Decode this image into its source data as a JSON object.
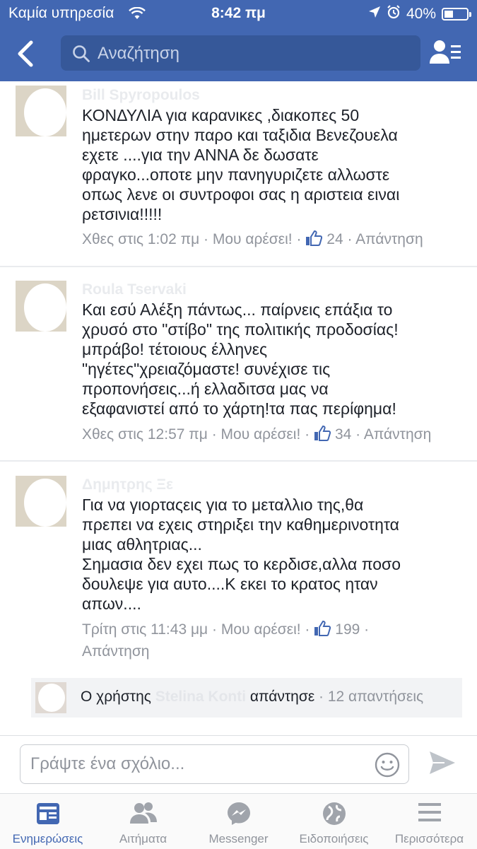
{
  "status_bar": {
    "carrier": "Καμία υπηρεσία",
    "time": "8:42 πμ",
    "battery": "40%",
    "battery_level": 0.4
  },
  "nav": {
    "search_placeholder": "Αναζήτηση"
  },
  "comments": [
    {
      "author": "Bill Spyropoulos",
      "lines": [
        "ΚΟΝΔΥΛΙΑ για καρανικες ,διακοπες 50",
        "ημετερων στην παρο και ταξιδια Βενεζουελα",
        "εχετε ....για την ΑΝΝΑ δε δωσατε",
        "φραγκο...οποτε μην πανηγυριζετε αλλωστε",
        "οπως λενε οι συντροφοι σας η αριστεια ειναι",
        "ρετσινια!!!!!"
      ],
      "time": "Χθες στις 1:02 πμ",
      "like_label": "Μου αρέσει!",
      "like_count": "24",
      "reply_label": "Απάντηση"
    },
    {
      "author": "Roula Tservaki",
      "lines": [
        "Και εσύ Αλέξη πάντως... παίρνεις επάξια το",
        "χρυσό στο \"στίβο\" της πολιτικής προδοσίας!",
        "μπράβο! τέτοιους έλληνες",
        "\"ηγέτες\"χρειαζόμαστε! συνέχισε τις",
        "προπονήσεις...ή ελλαδιτσα μας να",
        "εξαφανιστεί από το χάρτη!τα πας περίφημα!"
      ],
      "time": "Χθες στις 12:57 πμ",
      "like_label": "Μου αρέσει!",
      "like_count": "34",
      "reply_label": "Απάντηση"
    },
    {
      "author": "Δημητρης Ξε",
      "lines": [
        "Για να γιορταςεις για το μεταλλιο της,θα",
        "πρεπει να εχεις στηριξει την καθημερινοτητα",
        "μιας αθλητριας...",
        "Σημασια δεν εχει πως το κερδισε,αλλα ποσο",
        "δουλεψε για αυτο....Κ εκει το κρατος ηταν",
        "απων...."
      ],
      "time": "Τρίτη στις 11:43 μμ",
      "like_label": "Μου αρέσει!",
      "like_count": "199",
      "reply_label": "Απάντηση"
    }
  ],
  "replies_row": {
    "prefix": "Ο χρήστης",
    "name": "Stelina Konti",
    "action": "απάντησε",
    "count": "12 απαντήσεις"
  },
  "compose": {
    "placeholder": "Γράψτε ένα σχόλιο..."
  },
  "tabs": [
    {
      "label": "Ενημερώσεις",
      "icon": "news-feed-icon",
      "active": true
    },
    {
      "label": "Αιτήματα",
      "icon": "friend-requests-icon",
      "active": false
    },
    {
      "label": "Messenger",
      "icon": "messenger-icon",
      "active": false
    },
    {
      "label": "Ειδοποιήσεις",
      "icon": "globe-notifications-icon",
      "active": false
    },
    {
      "label": "Περισσότερα",
      "icon": "menu-icon",
      "active": false
    }
  ],
  "colors": {
    "brand": "#4267b2",
    "meta_text": "#90949c",
    "body_text": "#1d2129"
  }
}
